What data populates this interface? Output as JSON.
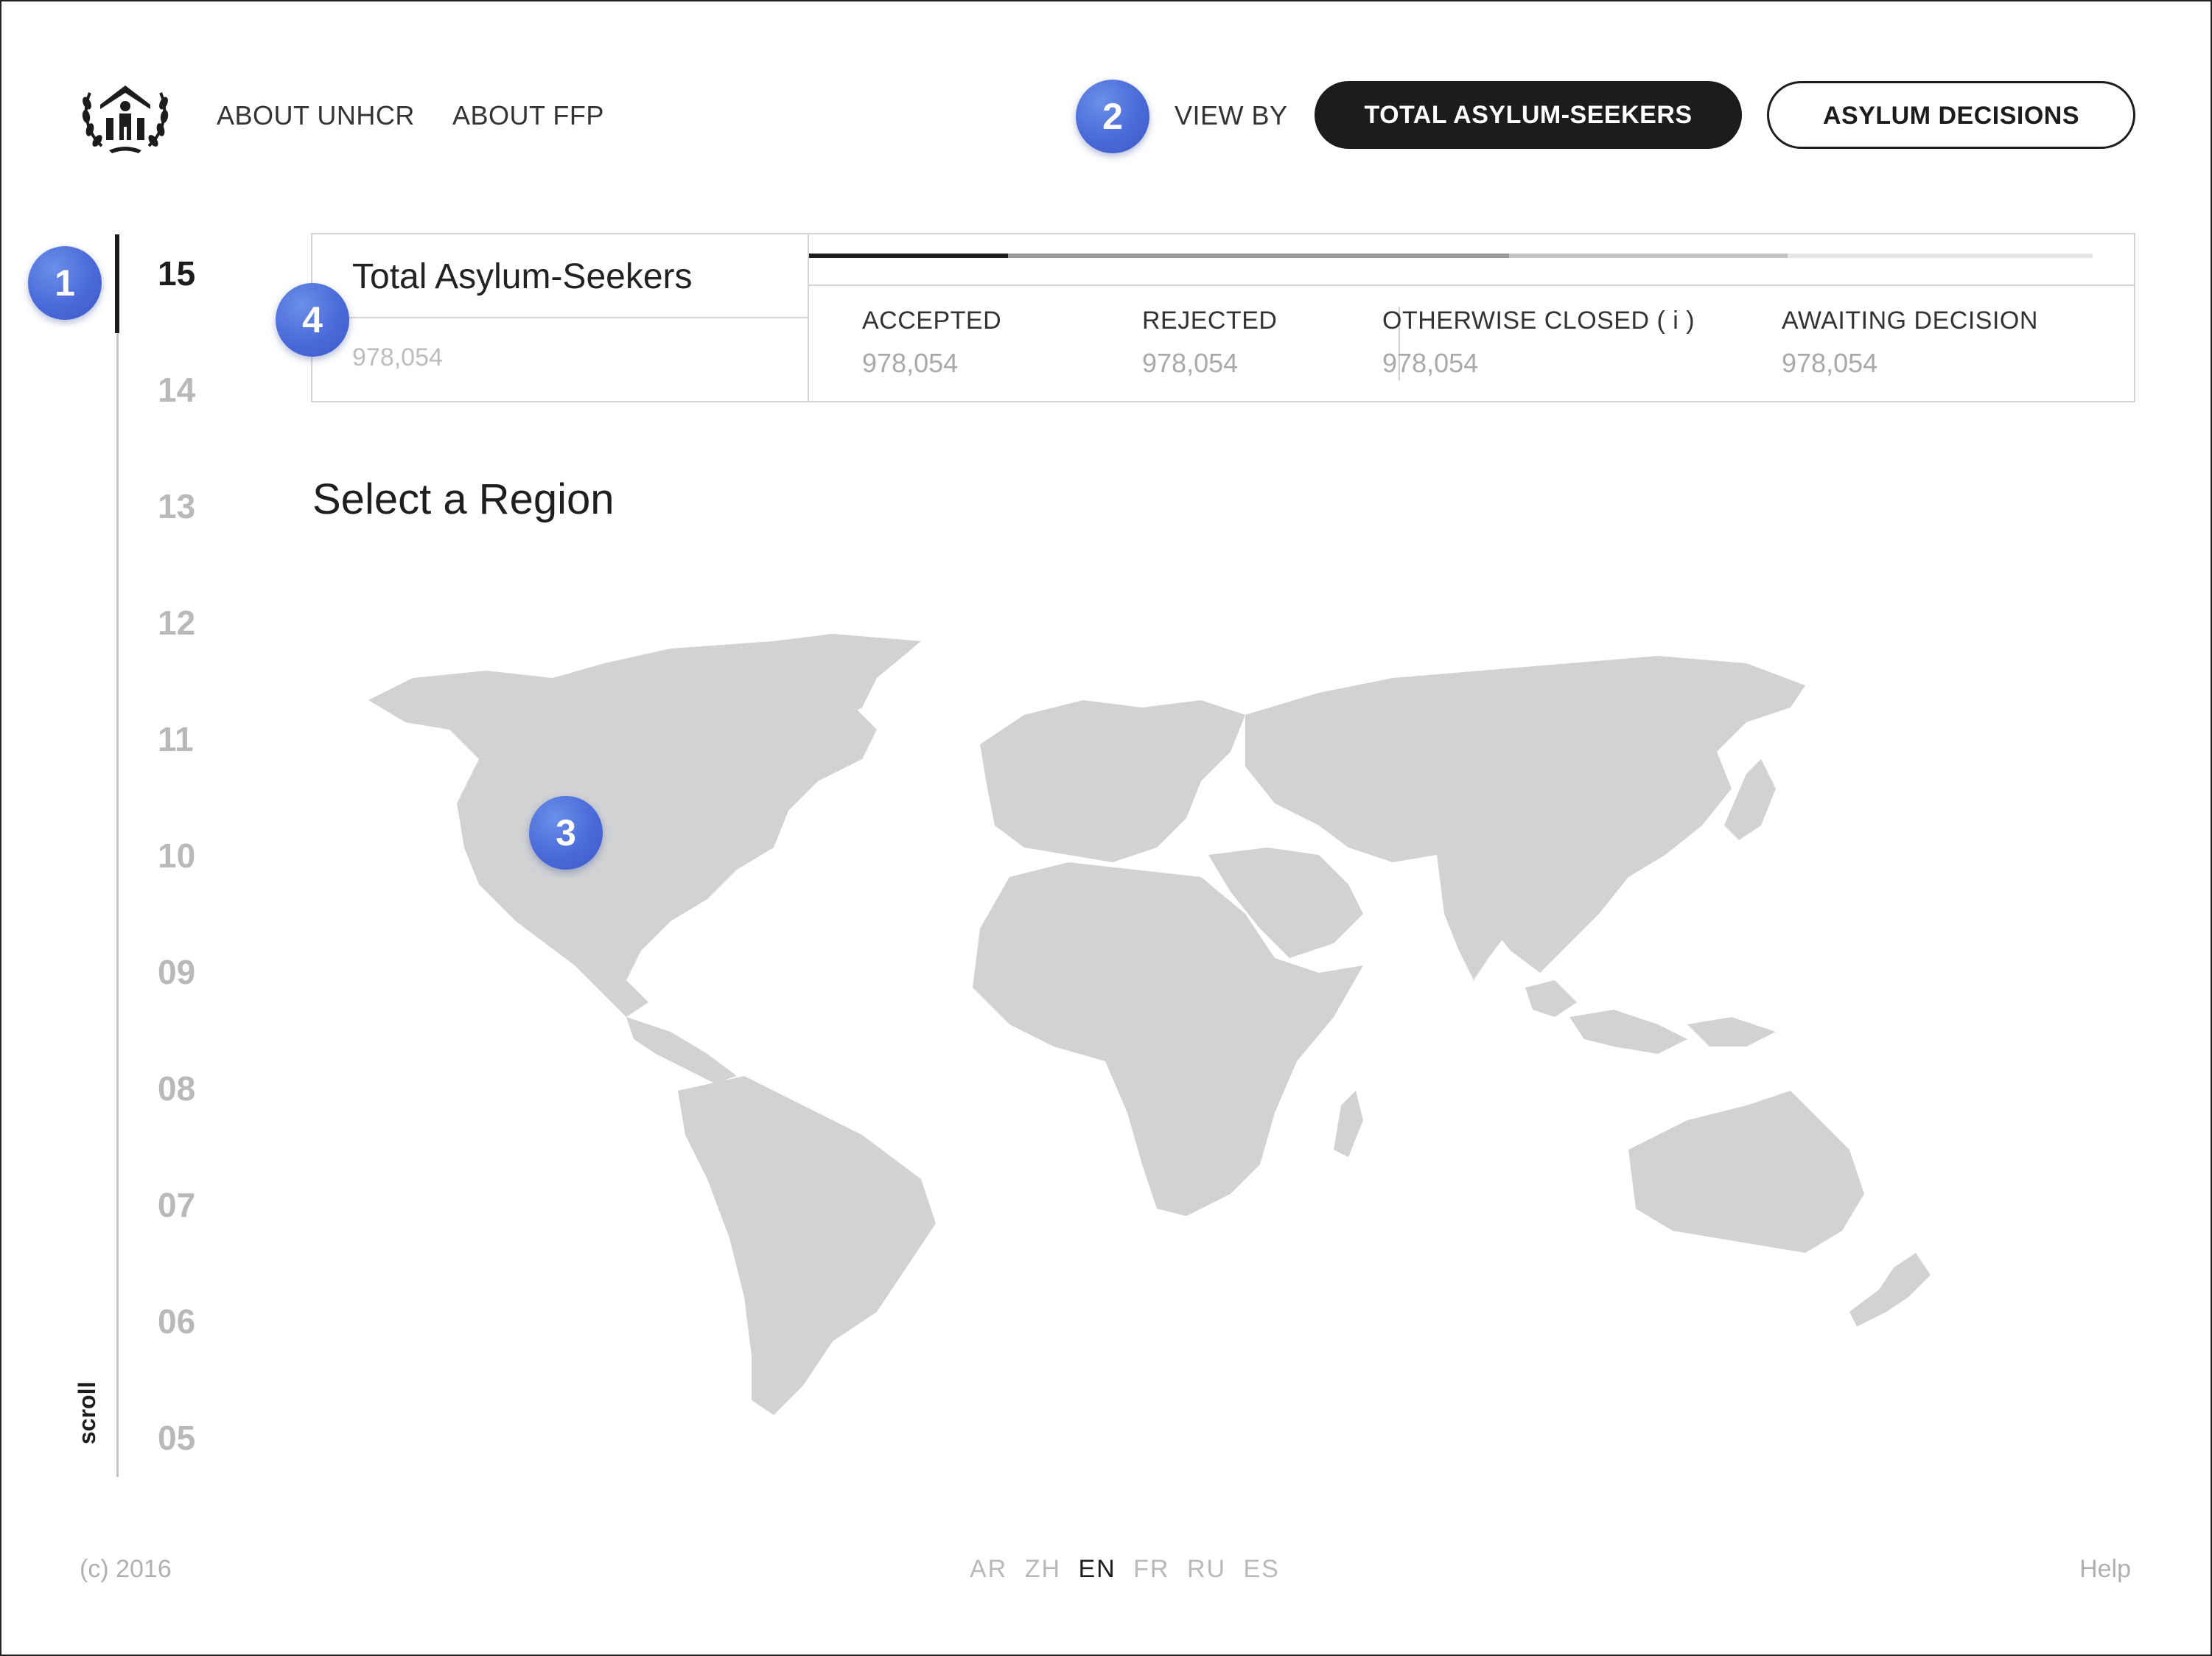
{
  "header": {
    "logo_alt": "UNHCR logo",
    "nav": [
      "ABOUT UNHCR",
      "ABOUT FFP"
    ],
    "view_by_label": "VIEW BY",
    "view_options": [
      "TOTAL ASYLUM-SEEKERS",
      "ASYLUM DECISIONS"
    ],
    "active_view": "TOTAL ASYLUM-SEEKERS"
  },
  "badges": [
    "1",
    "2",
    "3",
    "4"
  ],
  "timeline": {
    "years": [
      "15",
      "14",
      "13",
      "12",
      "11",
      "10",
      "09",
      "08",
      "07",
      "06",
      "05"
    ],
    "active_year": "15",
    "scroll_label": "scroll"
  },
  "summary": {
    "title": "Total Asylum-Seekers",
    "total": "978,054",
    "stats": [
      {
        "label": "ACCEPTED",
        "value": "978,054"
      },
      {
        "label": "REJECTED",
        "value": "978,054"
      },
      {
        "label": "OTHERWISE CLOSED ( i )",
        "value": "978,054"
      },
      {
        "label": "AWAITING DECISION",
        "value": "978,054"
      }
    ],
    "bar_colors": [
      "#1c1c1e",
      "#9a9a9a",
      "#c4c4c4",
      "#e6e6e6"
    ]
  },
  "region_title": "Select a Region",
  "footer": {
    "copyright": "(c) 2016",
    "languages": [
      "AR",
      "ZH",
      "EN",
      "FR",
      "RU",
      "ES"
    ],
    "active_language": "EN",
    "help": "Help"
  }
}
